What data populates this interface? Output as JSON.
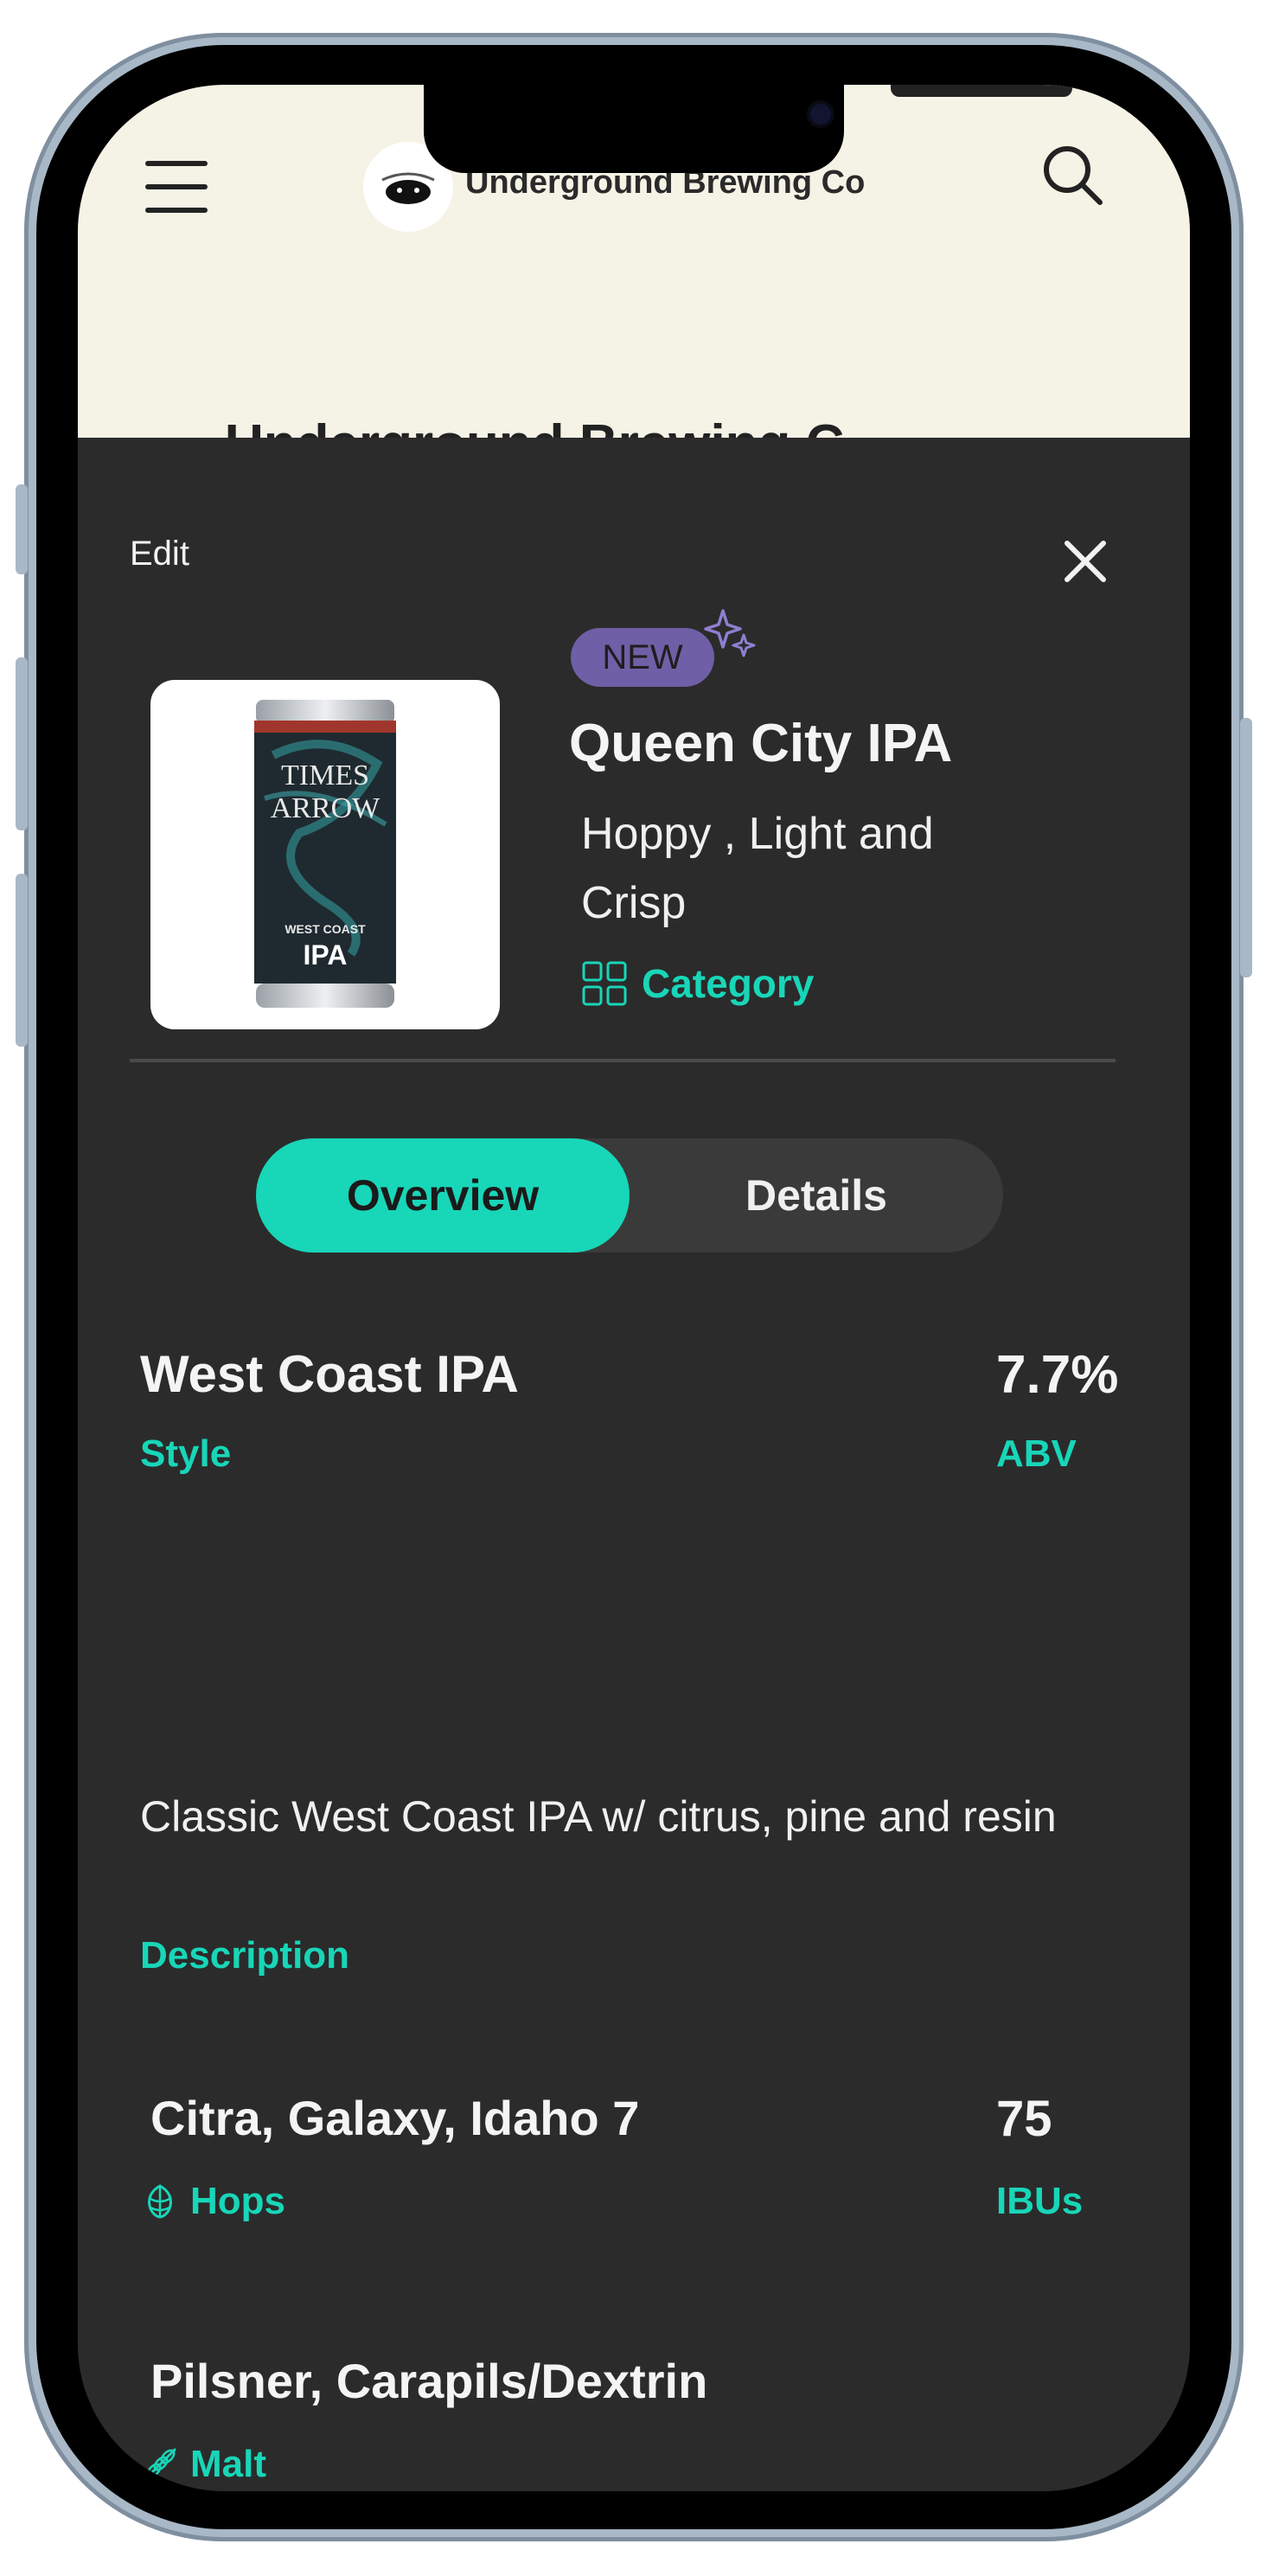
{
  "header": {
    "brand_name": "Underground Brewing Co",
    "page_title_peek": "Underground Brewing C"
  },
  "sheet": {
    "edit_label": "Edit",
    "badge": "NEW",
    "product_name": "Queen City IPA",
    "tagline": "Hoppy , Light and Crisp",
    "category_label": "Category",
    "image_alt": "Times Arrow West Coast IPA can"
  },
  "can_art": {
    "line1": "TIMES",
    "line2": "ARROW",
    "subtitle": "WEST COAST",
    "style": "IPA"
  },
  "tabs": [
    {
      "label": "Overview",
      "active": true
    },
    {
      "label": "Details",
      "active": false
    }
  ],
  "overview": {
    "style": {
      "value": "West Coast IPA",
      "label": "Style"
    },
    "abv": {
      "value": "7.7%",
      "label": "ABV"
    },
    "description": {
      "value": "Classic West Coast IPA w/ citrus, pine and resin",
      "label": "Description"
    },
    "hops": {
      "value": "Citra,  Galaxy,  Idaho 7",
      "label": "Hops"
    },
    "ibus": {
      "value": "75",
      "label": "IBUs"
    },
    "malt": {
      "value": "Pilsner,  Carapils/Dextrin",
      "label": "Malt"
    }
  },
  "icons": {
    "menu": "hamburger-icon",
    "search": "search-icon",
    "close": "close-icon",
    "sparkle": "sparkle-icon",
    "category": "grid-icon",
    "hops": "hop-icon",
    "malt": "wheat-icon"
  },
  "colors": {
    "accent": "#18d6b8",
    "sheet_bg": "#2b2b2b",
    "header_bg": "#f5f2e6",
    "badge_bg": "#6f5fa6"
  }
}
